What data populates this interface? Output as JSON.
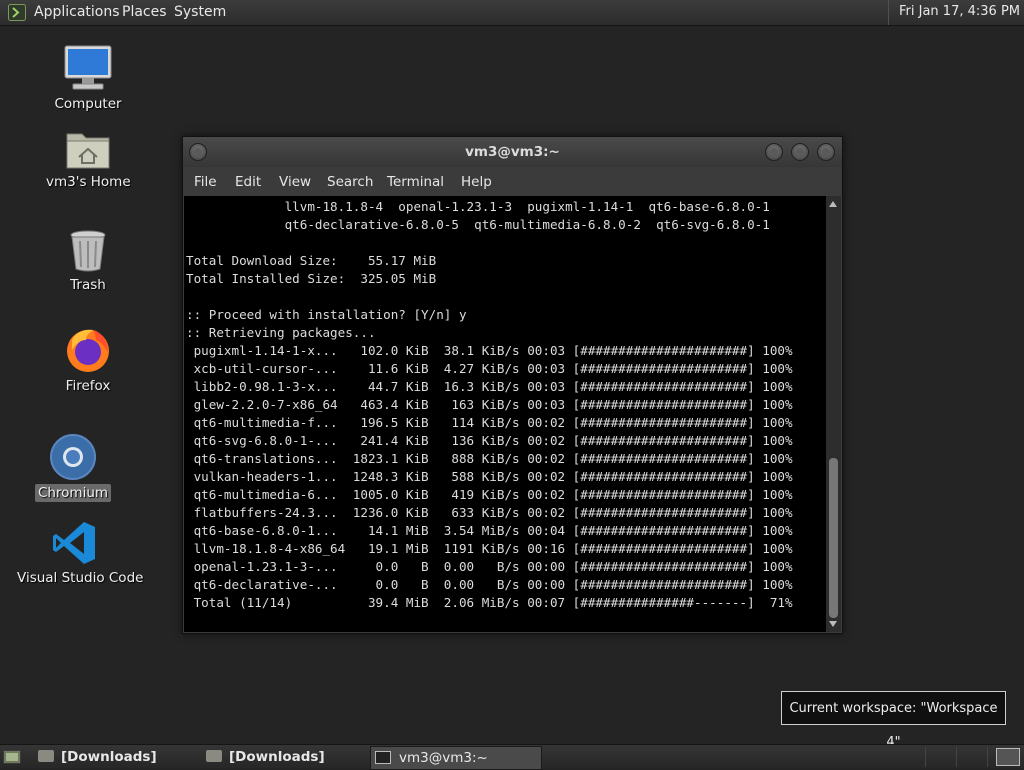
{
  "top_panel": {
    "menus": [
      "Applications",
      "Places",
      "System"
    ],
    "clock": "Fri Jan 17,  4:36 PM"
  },
  "desktop_icons": [
    {
      "label": "Computer",
      "icon": "computer-icon"
    },
    {
      "label": "vm3's Home",
      "icon": "home-folder-icon"
    },
    {
      "label": "Trash",
      "icon": "trash-icon"
    },
    {
      "label": "Firefox",
      "icon": "firefox-icon"
    },
    {
      "label": "Chromium",
      "icon": "chromium-icon",
      "selected": true
    },
    {
      "label": "Visual Studio Code",
      "icon": "vscode-icon"
    }
  ],
  "terminal": {
    "title": "vm3@vm3:~",
    "menu": [
      "File",
      "Edit",
      "View",
      "Search",
      "Terminal",
      "Help"
    ],
    "output": "             llvm-18.1.8-4  openal-1.23.1-3  pugixml-1.14-1  qt6-base-6.8.0-1\n             qt6-declarative-6.8.0-5  qt6-multimedia-6.8.0-2  qt6-svg-6.8.0-1\n\nTotal Download Size:    55.17 MiB\nTotal Installed Size:  325.05 MiB\n\n:: Proceed with installation? [Y/n] y\n:: Retrieving packages...\n pugixml-1.14-1-x...   102.0 KiB  38.1 KiB/s 00:03 [######################] 100%\n xcb-util-cursor-...    11.6 KiB  4.27 KiB/s 00:03 [######################] 100%\n libb2-0.98.1-3-x...    44.7 KiB  16.3 KiB/s 00:03 [######################] 100%\n glew-2.2.0-7-x86_64   463.4 KiB   163 KiB/s 00:03 [######################] 100%\n qt6-multimedia-f...   196.5 KiB   114 KiB/s 00:02 [######################] 100%\n qt6-svg-6.8.0-1-...   241.4 KiB   136 KiB/s 00:02 [######################] 100%\n qt6-translations...  1823.1 KiB   888 KiB/s 00:02 [######################] 100%\n vulkan-headers-1...  1248.3 KiB   588 KiB/s 00:02 [######################] 100%\n qt6-multimedia-6...  1005.0 KiB   419 KiB/s 00:02 [######################] 100%\n flatbuffers-24.3...  1236.0 KiB   633 KiB/s 00:02 [######################] 100%\n qt6-base-6.8.0-1...    14.1 MiB  3.54 MiB/s 00:04 [######################] 100%\n llvm-18.1.8-4-x86_64   19.1 MiB  1191 KiB/s 00:16 [######################] 100%\n openal-1.23.1-3-...     0.0   B  0.00   B/s 00:00 [######################] 100%\n qt6-declarative-...     0.0   B  0.00   B/s 00:00 [######################] 100%\n Total (11/14)          39.4 MiB  2.06 MiB/s 00:07 [###############-------]  71%"
  },
  "tooltip": "Current workspace: \"Workspace 4\"",
  "taskbar": {
    "items": [
      {
        "label": "[Downloads]",
        "icon": "folder-icon"
      },
      {
        "label": "[Downloads]",
        "icon": "folder-icon"
      },
      {
        "label": "vm3@vm3:~",
        "icon": "terminal-icon",
        "active": true
      }
    ]
  }
}
